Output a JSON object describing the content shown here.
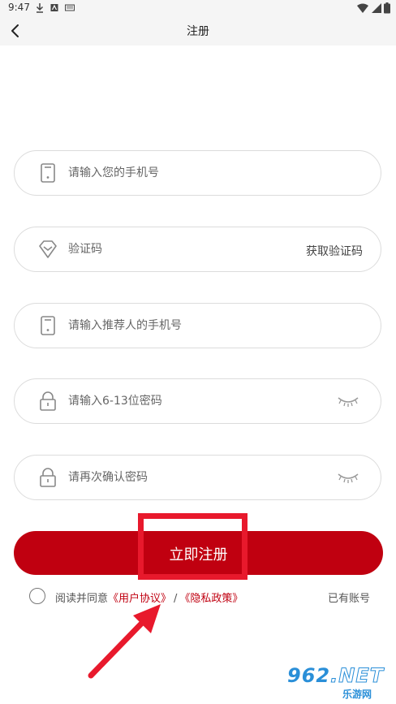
{
  "status_bar": {
    "time": "9:47"
  },
  "header": {
    "title": "注册"
  },
  "fields": {
    "phone_placeholder": "请输入您的手机号",
    "code_placeholder": "验证码",
    "get_code_label": "获取验证码",
    "referrer_placeholder": "请输入推荐人的手机号",
    "password_placeholder": "请输入6-13位密码",
    "confirm_placeholder": "请再次确认密码"
  },
  "register": {
    "label": "立即注册"
  },
  "agreement": {
    "prefix": "阅读并同意",
    "user_agreement": "《用户协议》",
    "separator": "/",
    "privacy_policy": "《隐私政策》",
    "has_account": "已有账号"
  },
  "watermark": {
    "brand": "962",
    "suffix": ".NET",
    "site": "乐游网"
  },
  "colors": {
    "accent": "#c00010",
    "highlight": "#e8192c",
    "border": "#dcdcdc",
    "watermark": "#2a8fd8"
  }
}
